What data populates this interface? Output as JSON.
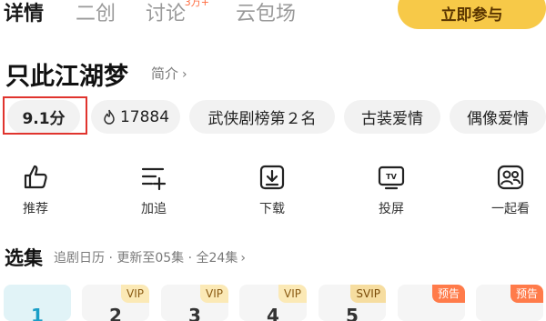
{
  "tabs": {
    "detail": "详情",
    "second": "二创",
    "discuss": "讨论",
    "discuss_badge": "3万+",
    "cloud": "云包场"
  },
  "join_button": "立即参与",
  "show": {
    "title": "只此江湖梦",
    "intro": "简介",
    "score": "9.1分",
    "heat": "17884",
    "chips": [
      "武侠剧榜第２名",
      "古装爱情",
      "偶像爱情"
    ]
  },
  "actions": [
    "推荐",
    "加追",
    "下载",
    "投屏",
    "一起看"
  ],
  "episodes": {
    "title": "选集",
    "meta": "追剧日历 · 更新至05集 · 全24集",
    "tags": [
      "VIP",
      "VIP",
      "VIP",
      "SVIP",
      "预告",
      "预告"
    ],
    "items": [
      "1",
      "2",
      "3",
      "4",
      "5",
      "",
      ""
    ]
  },
  "colors": {
    "accent": "#f7c948",
    "highlight": "#e0342e",
    "preview": "#ff7b4a"
  },
  "icons": [
    "flame-icon",
    "thumbs-up-icon",
    "add-list-icon",
    "download-icon",
    "tv-icon",
    "watch-together-icon",
    "chevron-right-icon"
  ]
}
